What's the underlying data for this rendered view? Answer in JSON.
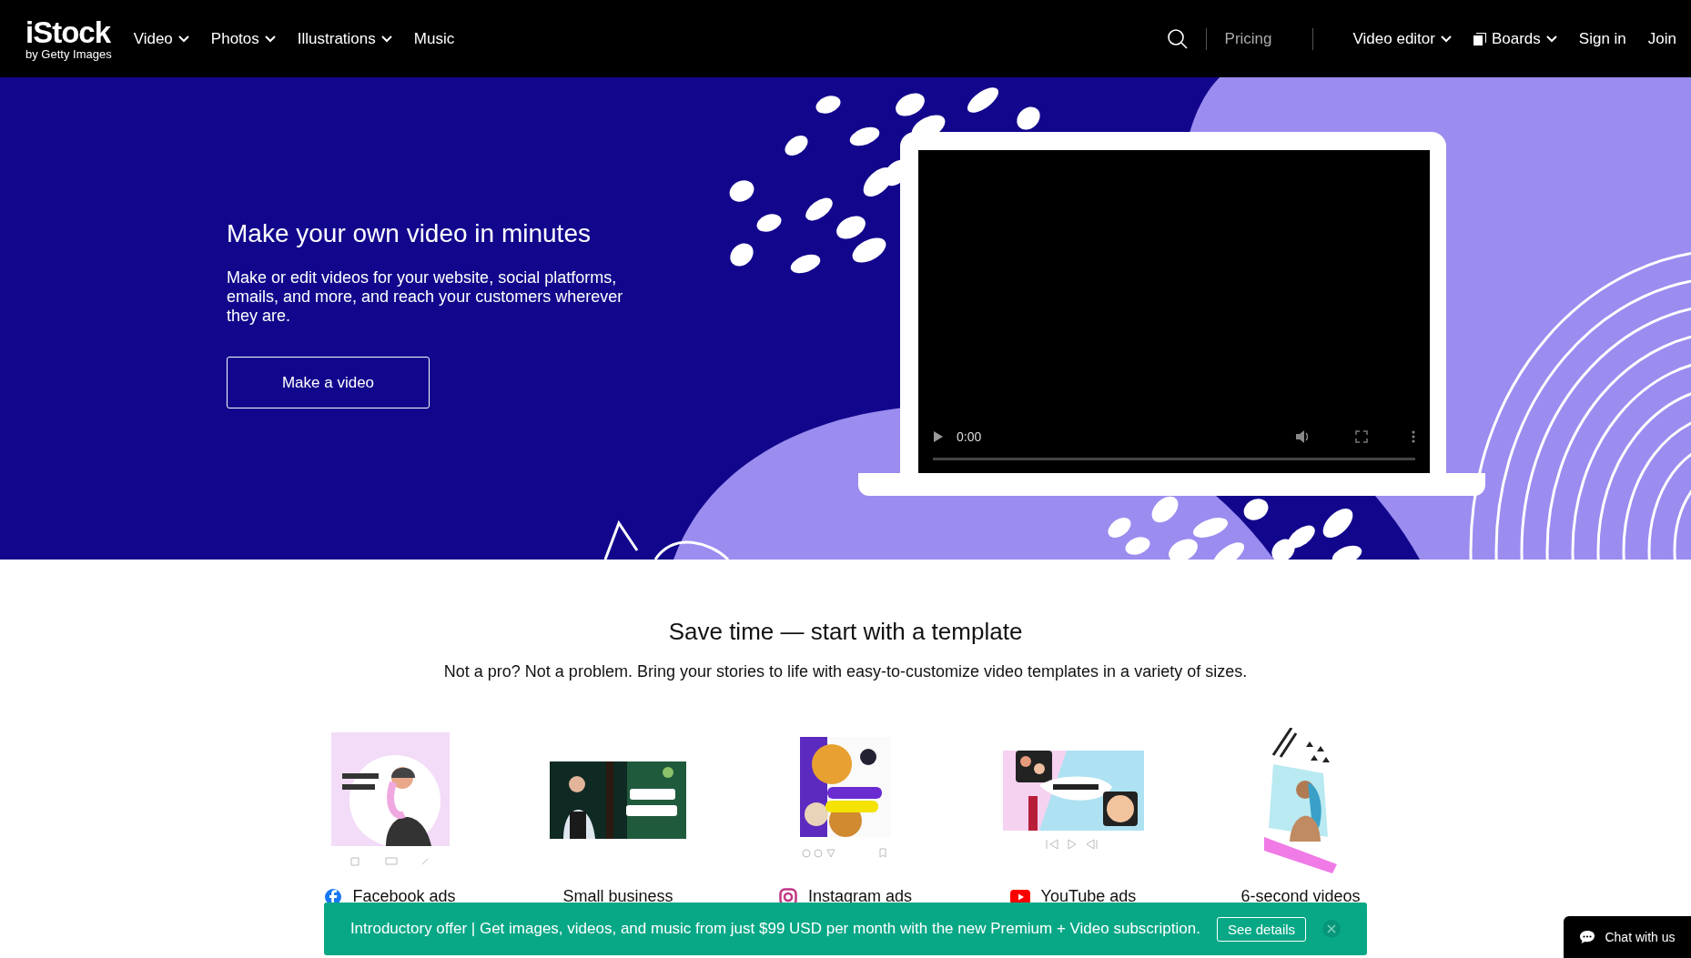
{
  "header": {
    "logo": {
      "name": "iStock",
      "tagline": "by Getty Images"
    },
    "nav": [
      {
        "label": "Video",
        "dropdown": true
      },
      {
        "label": "Photos",
        "dropdown": true
      },
      {
        "label": "Illustrations",
        "dropdown": true
      },
      {
        "label": "Music",
        "dropdown": false
      }
    ],
    "right_nav": [
      {
        "kind": "plain",
        "label": "Pricing",
        "dimmed": true,
        "dropdown": false
      },
      {
        "kind": "plain",
        "label": "Video editor",
        "dimmed": false,
        "dropdown": true
      },
      {
        "kind": "boards",
        "label": "Boards",
        "dimmed": false,
        "dropdown": true
      },
      {
        "kind": "plain",
        "label": "Sign in",
        "dimmed": false,
        "dropdown": false
      },
      {
        "kind": "plain",
        "label": "Join",
        "dimmed": false,
        "dropdown": false
      }
    ]
  },
  "hero": {
    "title": "Make your own video in minutes",
    "text": "Make or edit videos for your website, social platforms, emails, and more, and reach your customers wherever they are.",
    "button": "Make a video",
    "video": {
      "time": "0:00",
      "level": 0
    }
  },
  "templates": {
    "title": "Save time — start with a template",
    "subtitle": "Not a pro? Not a problem. Bring your stories to life with easy-to-customize video templates in a variety of sizes.",
    "items": [
      {
        "kind": "facebook",
        "label": "Facebook ads"
      },
      {
        "kind": "business",
        "label": "Small business"
      },
      {
        "kind": "instagram",
        "label": "Instagram ads"
      },
      {
        "kind": "youtube",
        "label": "YouTube ads"
      },
      {
        "kind": "short",
        "label": "6-second videos"
      }
    ]
  },
  "banner": {
    "text": "Introductory offer | Get images, videos, and music from just $99 USD per month with the new Premium + Video subscription.",
    "button": "See details"
  },
  "chat": {
    "label": "Chat with us"
  }
}
